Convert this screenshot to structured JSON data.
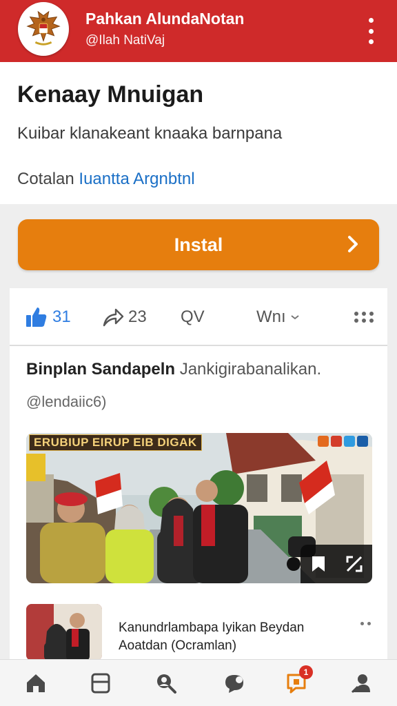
{
  "header": {
    "title": "Pahkan AlundaNotan",
    "handle": "@Ilah NatiVaj",
    "logo_icon": "garuda-emblem-icon",
    "menu_icon": "kebab-menu-icon",
    "bg_color": "#cf2a2a"
  },
  "intro": {
    "title": "Kenaay Mnuigan",
    "subtitle": "Kuibar klanakeant knaaka barnpana",
    "footer_prefix": "Cotalan",
    "footer_link": "Iuantta Argnbtnl"
  },
  "install": {
    "label": "Instal",
    "color": "#e67e0e",
    "icon": "chevron-right-icon"
  },
  "post": {
    "actions": {
      "like_count": "31",
      "share_count": "23",
      "view_label": "QV",
      "who_label": "Wnı"
    },
    "author_name": "Binplan Sandapeln",
    "author_rest": "Jankigirabanalikan.",
    "handle": "@lendaiic6)",
    "photo_banner": "ERUBIUP EIRUP EIB DIGAK",
    "related": {
      "title": "Kanundrlambapa Iyikan Beydan",
      "subtitle": "Aoatdan (Ocramlan)"
    }
  },
  "bottom_nav": {
    "items": [
      "home-icon",
      "tabs-icon",
      "search-people-icon",
      "chat-icon",
      "notifications-icon",
      "profile-icon"
    ],
    "notification_badge": "1",
    "active_color": "#e67e0e"
  }
}
